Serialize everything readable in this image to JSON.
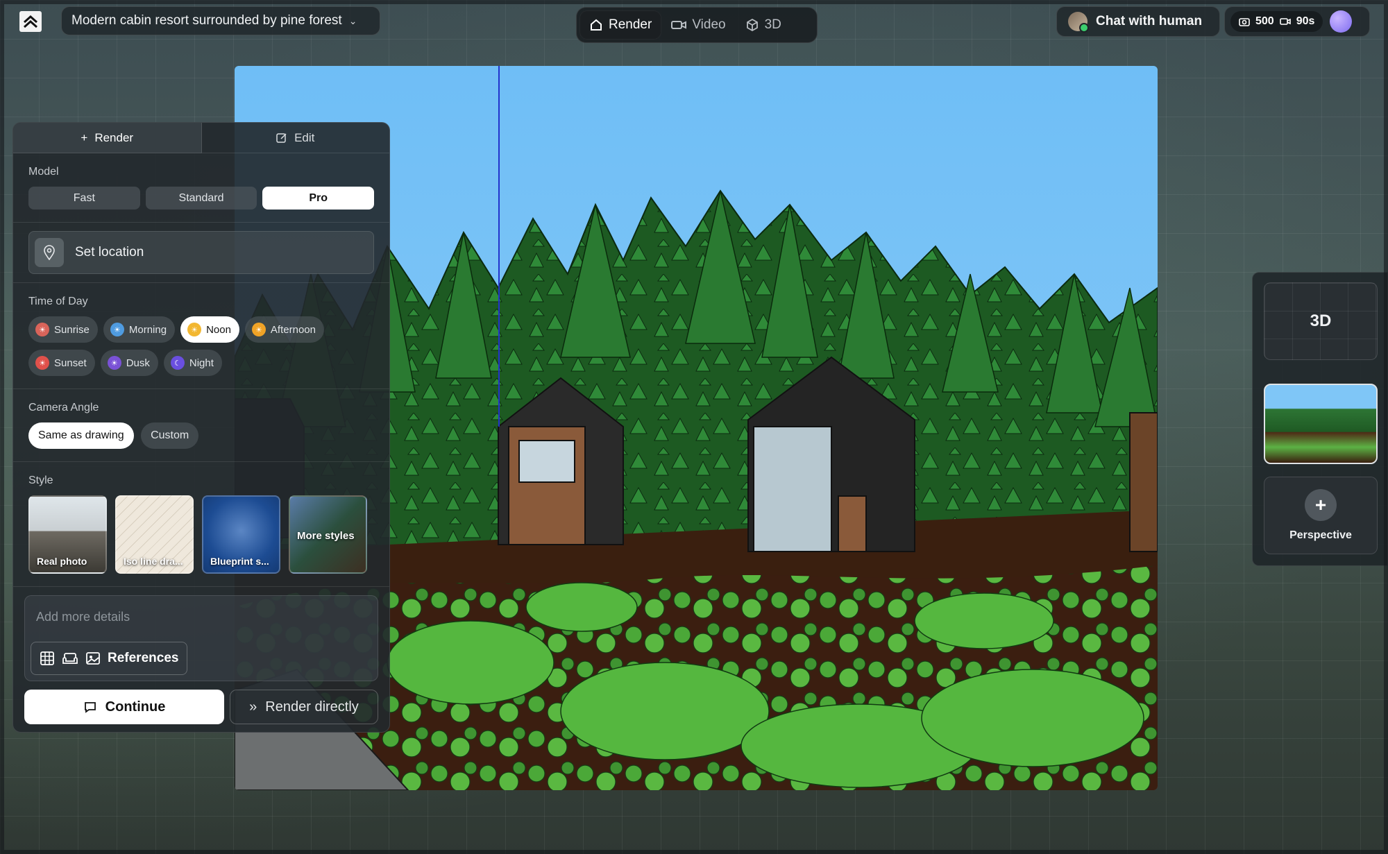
{
  "header": {
    "project_title": "Modern cabin resort surrounded by pine forest",
    "mode_tabs": [
      {
        "label": "Render",
        "icon": "home-icon",
        "active": true
      },
      {
        "label": "Video",
        "icon": "video-icon",
        "active": false
      },
      {
        "label": "3D",
        "icon": "cube-icon",
        "active": false
      }
    ],
    "chat_label": "Chat with human",
    "credits_images": "500",
    "credits_video": "90s"
  },
  "panel": {
    "tabs": [
      {
        "label": "Render",
        "icon": "plus-icon",
        "active": true
      },
      {
        "label": "Edit",
        "icon": "edit-icon",
        "active": false
      }
    ],
    "model": {
      "label": "Model",
      "options": [
        "Fast",
        "Standard",
        "Pro"
      ],
      "selected": "Pro"
    },
    "location_label": "Set location",
    "time_of_day": {
      "label": "Time of Day",
      "options": [
        {
          "label": "Sunrise",
          "color": "#d9645a",
          "active": false
        },
        {
          "label": "Morning",
          "color": "#4f9be0",
          "active": false
        },
        {
          "label": "Noon",
          "color": "#f2b731",
          "active": true
        },
        {
          "label": "Afternoon",
          "color": "#f0a326",
          "active": false
        },
        {
          "label": "Sunset",
          "color": "#e0514b",
          "active": false
        },
        {
          "label": "Dusk",
          "color": "#7a52d6",
          "active": false
        },
        {
          "label": "Night",
          "color": "#6a4fe0",
          "active": false
        }
      ]
    },
    "camera": {
      "label": "Camera Angle",
      "options": [
        "Same as drawing",
        "Custom"
      ],
      "selected": "Same as drawing"
    },
    "style": {
      "label": "Style",
      "cards": [
        "Real photo",
        "Iso line dra...",
        "Blueprint s...",
        "More styles"
      ]
    },
    "details_placeholder": "Add more details",
    "references_label": "References",
    "continue_label": "Continue",
    "render_direct_label": "Render directly"
  },
  "right_panel": {
    "three_d_label": "3D",
    "perspective_label": "Perspective"
  },
  "colors": {
    "accent": "#ffffff",
    "panel_bg": "#22282c",
    "sky": "#7fc6f7",
    "pine": "#2f7d3a"
  }
}
